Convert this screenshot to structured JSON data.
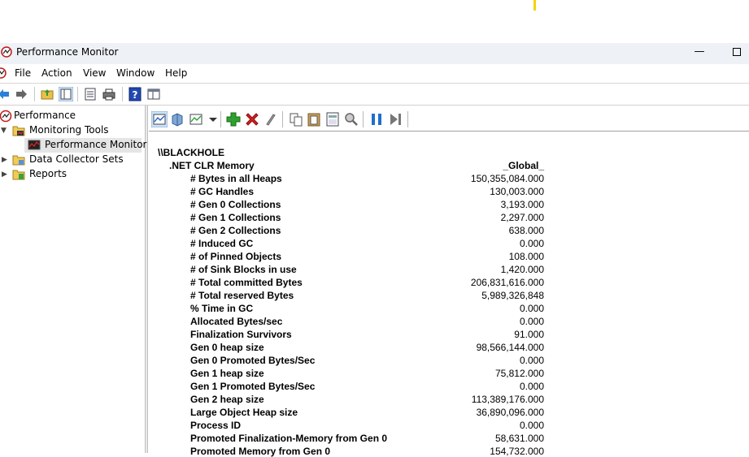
{
  "window": {
    "title": "Performance Monitor"
  },
  "menu": {
    "items": [
      "File",
      "Action",
      "View",
      "Window",
      "Help"
    ]
  },
  "tree": {
    "root": "Performance",
    "monitoring_tools": "Monitoring Tools",
    "performance_monitor": "Performance Monitor",
    "data_collector_sets": "Data Collector Sets",
    "reports": "Reports"
  },
  "report": {
    "machine": "\\\\BLACKHOLE",
    "category": ".NET CLR Memory",
    "instance": "_Global_",
    "counters": [
      {
        "name": "# Bytes in all Heaps",
        "value": "150,355,084.000"
      },
      {
        "name": "# GC Handles",
        "value": "130,003.000"
      },
      {
        "name": "# Gen 0 Collections",
        "value": "3,193.000"
      },
      {
        "name": "# Gen 1 Collections",
        "value": "2,297.000"
      },
      {
        "name": "# Gen 2 Collections",
        "value": "638.000"
      },
      {
        "name": "# Induced GC",
        "value": "0.000"
      },
      {
        "name": "# of Pinned Objects",
        "value": "108.000"
      },
      {
        "name": "# of Sink Blocks in use",
        "value": "1,420.000"
      },
      {
        "name": "# Total committed Bytes",
        "value": "206,831,616.000"
      },
      {
        "name": "# Total reserved Bytes",
        "value": "5,989,326,848"
      },
      {
        "name": "% Time in GC",
        "value": "0.000"
      },
      {
        "name": "Allocated Bytes/sec",
        "value": "0.000"
      },
      {
        "name": "Finalization Survivors",
        "value": "91.000"
      },
      {
        "name": "Gen 0 heap size",
        "value": "98,566,144.000"
      },
      {
        "name": "Gen 0 Promoted Bytes/Sec",
        "value": "0.000"
      },
      {
        "name": "Gen 1 heap size",
        "value": "75,812.000"
      },
      {
        "name": "Gen 1 Promoted Bytes/Sec",
        "value": "0.000"
      },
      {
        "name": "Gen 2 heap size",
        "value": "113,389,176.000"
      },
      {
        "name": "Large Object Heap size",
        "value": "36,890,096.000"
      },
      {
        "name": "Process ID",
        "value": "0.000"
      },
      {
        "name": "Promoted Finalization-Memory from Gen 0",
        "value": "58,631.000"
      },
      {
        "name": "Promoted Memory from Gen 0",
        "value": "154,732.000"
      }
    ]
  },
  "colors": {
    "accent_blue": "#1f5fbf",
    "add_green": "#2ea12e",
    "delete_red": "#d42020",
    "selection": "#e5e5e5"
  },
  "icons": {
    "app": "perfmon-icon",
    "toolbar": [
      "back-arrow-icon",
      "forward-arrow-icon",
      "up-folder-icon",
      "show-hide-tree-icon",
      "properties-icon",
      "print-icon",
      "help-icon",
      "console-icon"
    ],
    "pm_toolbar": [
      "view-graph-icon",
      "view-histogram-icon",
      "change-graph-type-icon",
      "add-counter-icon",
      "delete-counter-icon",
      "highlight-icon",
      "copy-icon",
      "paste-icon",
      "properties-icon",
      "zoom-icon",
      "freeze-icon",
      "update-icon"
    ]
  }
}
